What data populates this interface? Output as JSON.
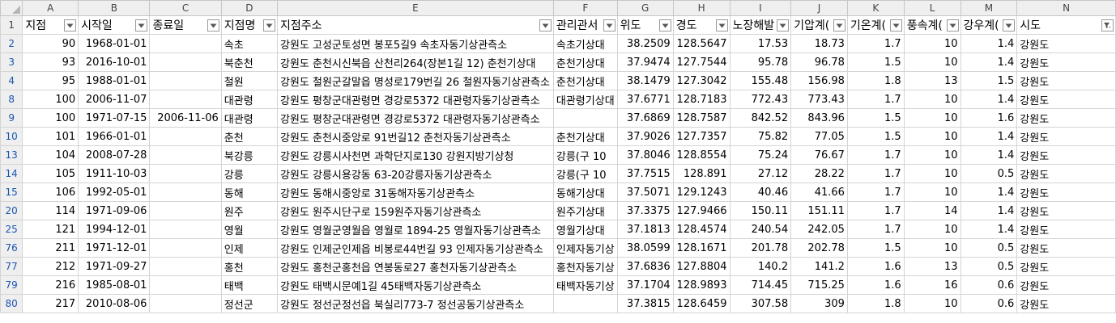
{
  "column_letters": [
    "A",
    "B",
    "C",
    "D",
    "E",
    "F",
    "G",
    "H",
    "I",
    "J",
    "K",
    "L",
    "M",
    "N"
  ],
  "headers": [
    "지점",
    "시작일",
    "종료일",
    "지점명",
    "지점주소",
    "관리관서",
    "위도",
    "경도",
    "노장해발",
    "기압계(",
    "기온계(",
    "풍속계(",
    "강우계(",
    "시도"
  ],
  "header_filter_icons": [
    "dropdown-arrow-icon",
    "dropdown-arrow-icon",
    "dropdown-arrow-icon",
    "dropdown-arrow-icon",
    "dropdown-arrow-icon",
    "dropdown-arrow-icon",
    "dropdown-arrow-icon",
    "dropdown-arrow-icon",
    "dropdown-arrow-icon",
    "dropdown-arrow-icon",
    "dropdown-arrow-icon",
    "dropdown-arrow-icon",
    "dropdown-arrow-icon",
    "filter-funnel-icon"
  ],
  "header_row_number": "1",
  "rows": [
    {
      "n": "2",
      "cells": [
        "90",
        "1968-01-01",
        "",
        "속초",
        "강원도 고성군토성면 봉포5길9 속초자동기상관측소",
        "속초기상대",
        "38.2509",
        "128.5647",
        "17.53",
        "18.73",
        "1.7",
        "10",
        "1.4",
        "강원도"
      ]
    },
    {
      "n": "3",
      "cells": [
        "93",
        "2016-10-01",
        "",
        "북춘천",
        "강원도 춘천시신북읍 산천리264(장본1길 12) 춘천기상대",
        "춘천기상대",
        "37.9474",
        "127.7544",
        "95.78",
        "96.78",
        "1.5",
        "10",
        "1.4",
        "강원도"
      ]
    },
    {
      "n": "4",
      "cells": [
        "95",
        "1988-01-01",
        "",
        "철원",
        "강원도 철원군갈말읍 명성로179번길 26 철원자동기상관측소",
        "춘천기상대",
        "38.1479",
        "127.3042",
        "155.48",
        "156.98",
        "1.8",
        "13",
        "1.5",
        "강원도"
      ]
    },
    {
      "n": "8",
      "cells": [
        "100",
        "2006-11-07",
        "",
        "대관령",
        "강원도 평창군대관령면 경강로5372 대관령자동기상관측소",
        "대관령기상대",
        "37.6771",
        "128.7183",
        "772.43",
        "773.43",
        "1.7",
        "10",
        "1.4",
        "강원도"
      ]
    },
    {
      "n": "9",
      "cells": [
        "100",
        "1971-07-15",
        "2006-11-06",
        "대관령",
        "강원도 평창군대관령면 경강로5372 대관령자동기상관측소",
        "",
        "37.6869",
        "128.7587",
        "842.52",
        "843.96",
        "1.5",
        "10",
        "1.6",
        "강원도"
      ]
    },
    {
      "n": "10",
      "cells": [
        "101",
        "1966-01-01",
        "",
        "춘천",
        "강원도 춘천시중앙로 91번길12 춘천자동기상관측소",
        "춘천기상대",
        "37.9026",
        "127.7357",
        "75.82",
        "77.05",
        "1.5",
        "10",
        "1.4",
        "강원도"
      ]
    },
    {
      "n": "13",
      "cells": [
        "104",
        "2008-07-28",
        "",
        "북강릉",
        "강원도 강릉시사천면 과학단지로130 강원지방기상청",
        "강릉(구 10",
        "37.8046",
        "128.8554",
        "75.24",
        "76.67",
        "1.7",
        "10",
        "1.4",
        "강원도"
      ]
    },
    {
      "n": "14",
      "cells": [
        "105",
        "1911-10-03",
        "",
        "강릉",
        "강원도 강릉시용강동 63-20강릉자동기상관측소",
        "강릉(구 10",
        "37.7515",
        "128.891",
        "27.12",
        "28.22",
        "1.7",
        "10",
        "0.5",
        "강원도"
      ]
    },
    {
      "n": "15",
      "cells": [
        "106",
        "1992-05-01",
        "",
        "동해",
        "강원도 동해시중앙로 31동해자동기상관측소",
        "동해기상대",
        "37.5071",
        "129.1243",
        "40.46",
        "41.66",
        "1.7",
        "10",
        "1.4",
        "강원도"
      ]
    },
    {
      "n": "20",
      "cells": [
        "114",
        "1971-09-06",
        "",
        "원주",
        "강원도 원주시단구로 159원주자동기상관측소",
        "원주기상대",
        "37.3375",
        "127.9466",
        "150.11",
        "151.11",
        "1.7",
        "14",
        "1.4",
        "강원도"
      ]
    },
    {
      "n": "25",
      "cells": [
        "121",
        "1994-12-01",
        "",
        "영월",
        "강원도 영월군영월읍 영월로 1894-25 영월자동기상관측소",
        "영월기상대",
        "37.1813",
        "128.4574",
        "240.54",
        "242.05",
        "1.7",
        "10",
        "1.4",
        "강원도"
      ]
    },
    {
      "n": "76",
      "cells": [
        "211",
        "1971-12-01",
        "",
        "인제",
        "강원도 인제군인제읍 비봉로44번길 93 인제자동기상관측소",
        "인제자동기상",
        "38.0599",
        "128.1671",
        "201.78",
        "202.78",
        "1.5",
        "10",
        "0.5",
        "강원도"
      ]
    },
    {
      "n": "77",
      "cells": [
        "212",
        "1971-09-27",
        "",
        "홍천",
        "강원도 홍천군홍천읍 연봉동로27 홍천자동기상관측소",
        "홍천자동기상",
        "37.6836",
        "127.8804",
        "140.2",
        "141.2",
        "1.6",
        "13",
        "0.5",
        "강원도"
      ]
    },
    {
      "n": "79",
      "cells": [
        "216",
        "1985-08-01",
        "",
        "태백",
        "강원도 태백시문예1길 45태백자동기상관측소",
        "태백자동기상",
        "37.1704",
        "128.9893",
        "714.45",
        "715.25",
        "1.6",
        "16",
        "0.6",
        "강원도"
      ]
    },
    {
      "n": "80",
      "cells": [
        "217",
        "2010-08-06",
        "",
        "정선군",
        "강원도 정선군정선읍 북실리773-7 정선공동기상관측소",
        "",
        "37.3815",
        "128.6459",
        "307.58",
        "309",
        "1.8",
        "10",
        "0.6",
        "강원도"
      ]
    }
  ]
}
